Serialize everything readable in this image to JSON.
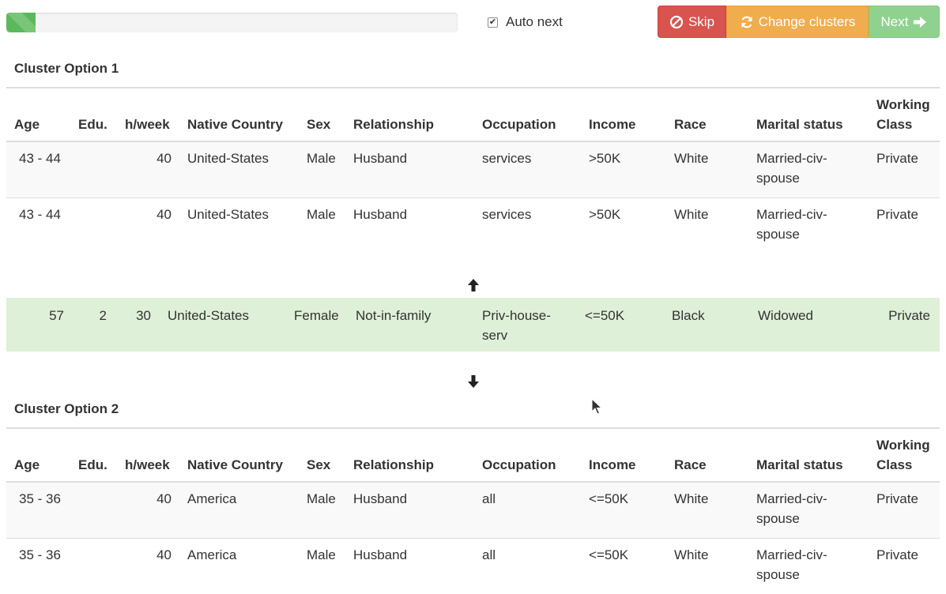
{
  "toolbar": {
    "progress_percent": 6.5,
    "auto_next_label": "Auto next",
    "auto_next_checked": true,
    "skip_label": "Skip",
    "change_clusters_label": "Change clusters",
    "next_label": "Next",
    "colors": {
      "skip": "#d9534f",
      "change": "#f0ad4e",
      "next": "#8fd28f",
      "progress": "#5cb85c"
    }
  },
  "columns": [
    "Age",
    "Edu.",
    "h/week",
    "Native Country",
    "Sex",
    "Relationship",
    "Occupation",
    "Income",
    "Race",
    "Marital status",
    "Working Class"
  ],
  "cluster1": {
    "title": "Cluster Option 1",
    "rows": [
      {
        "age": "43 - 44",
        "edu": "",
        "hweek": "40",
        "country": "United-States",
        "sex": "Male",
        "relationship": "Husband",
        "occupation": "services",
        "income": ">50K",
        "race": "White",
        "marital": "Married-civ-spouse",
        "working": "Private"
      },
      {
        "age": "43 - 44",
        "edu": "",
        "hweek": "40",
        "country": "United-States",
        "sex": "Male",
        "relationship": "Husband",
        "occupation": "services",
        "income": ">50K",
        "race": "White",
        "marital": "Married-civ-spouse",
        "working": "Private"
      }
    ]
  },
  "current": {
    "age": "57",
    "edu": "2",
    "hweek": "30",
    "country": "United-States",
    "sex": "Female",
    "relationship": "Not-in-family",
    "occupation": "Priv-house-serv",
    "income": "<=50K",
    "race": "Black",
    "marital": "Widowed",
    "working": "Private",
    "highlight_color": "#dff0d8"
  },
  "cluster2": {
    "title": "Cluster Option 2",
    "rows": [
      {
        "age": "35 - 36",
        "edu": "",
        "hweek": "40",
        "country": "America",
        "sex": "Male",
        "relationship": "Husband",
        "occupation": "all",
        "income": "<=50K",
        "race": "White",
        "marital": "Married-civ-spouse",
        "working": "Private"
      },
      {
        "age": "35 - 36",
        "edu": "",
        "hweek": "40",
        "country": "America",
        "sex": "Male",
        "relationship": "Husband",
        "occupation": "all",
        "income": "<=50K",
        "race": "White",
        "marital": "Married-civ-spouse",
        "working": "Private"
      }
    ]
  },
  "icons": {
    "up": "arrow-up-icon",
    "down": "arrow-down-icon",
    "skip": "ban-icon",
    "change": "refresh-icon",
    "next": "arrow-right-icon"
  }
}
